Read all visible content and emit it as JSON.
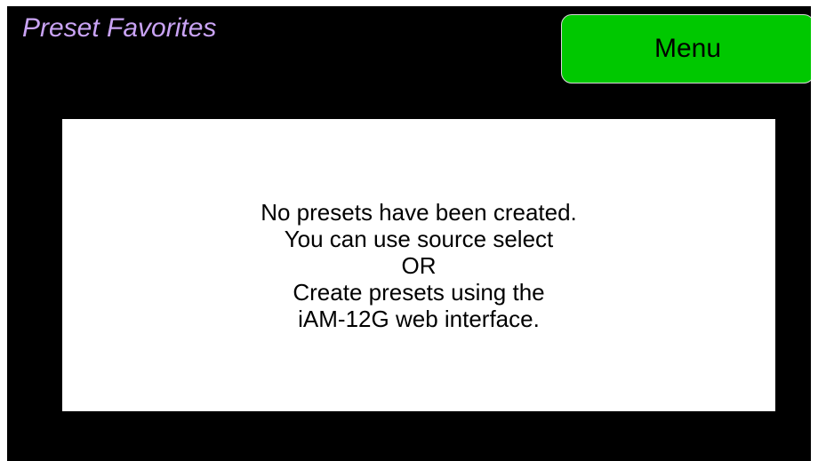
{
  "header": {
    "title": "Preset Favorites",
    "menu_label": "Menu"
  },
  "message": {
    "lines": [
      "No presets have been created.",
      "You can use source select",
      "OR",
      "Create presets using the",
      "iAM-12G web interface."
    ]
  },
  "colors": {
    "background": "#000000",
    "title": "#c9a3f4",
    "menu_button": "#00c800",
    "panel": "#ffffff"
  }
}
